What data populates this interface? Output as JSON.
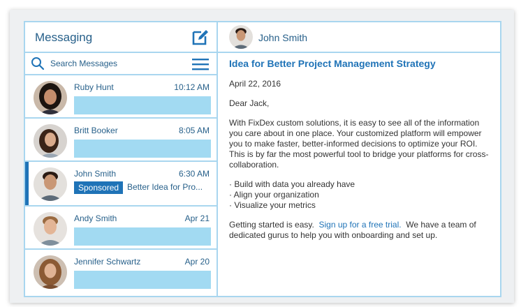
{
  "messaging": {
    "title": "Messaging",
    "search_placeholder": "Search Messages",
    "threads": [
      {
        "name": "Ruby Hunt",
        "time": "10:12 AM"
      },
      {
        "name": "Britt Booker",
        "time": "8:05 AM"
      },
      {
        "name": "John Smith",
        "time": "6:30 AM",
        "badge": "Sponsored",
        "preview": "Better Idea for Pro..."
      },
      {
        "name": "Andy Smith",
        "time": "Apr 21"
      },
      {
        "name": "Jennifer Schwartz",
        "time": "Apr 20"
      }
    ]
  },
  "conversation": {
    "contact_name": "John Smith",
    "subject": "Idea for Better Project Management Strategy",
    "date": "April 22, 2016",
    "greeting": "Dear Jack,",
    "body": "With FixDex custom solutions, it is easy to see all of the information you care about in one place. Your customized platform will empower you to make faster, better-informed decisions to optimize your ROI. This is by far the most powerful tool to bridge your platforms for cross-collaboration.",
    "bullets": [
      "· Build with data you already have",
      "· Align your organization",
      "· Visualize your metrics"
    ],
    "closing_start": "Getting started is easy.",
    "link_text": "Sign up for a free trial.",
    "closing_end": "We have a team of dedicated gurus to help you with onboarding and set up."
  },
  "colors": {
    "accent": "#1f73b7",
    "border": "#a9d6ef",
    "preview_fill": "#a2daf2",
    "text_blue": "#27608a"
  }
}
